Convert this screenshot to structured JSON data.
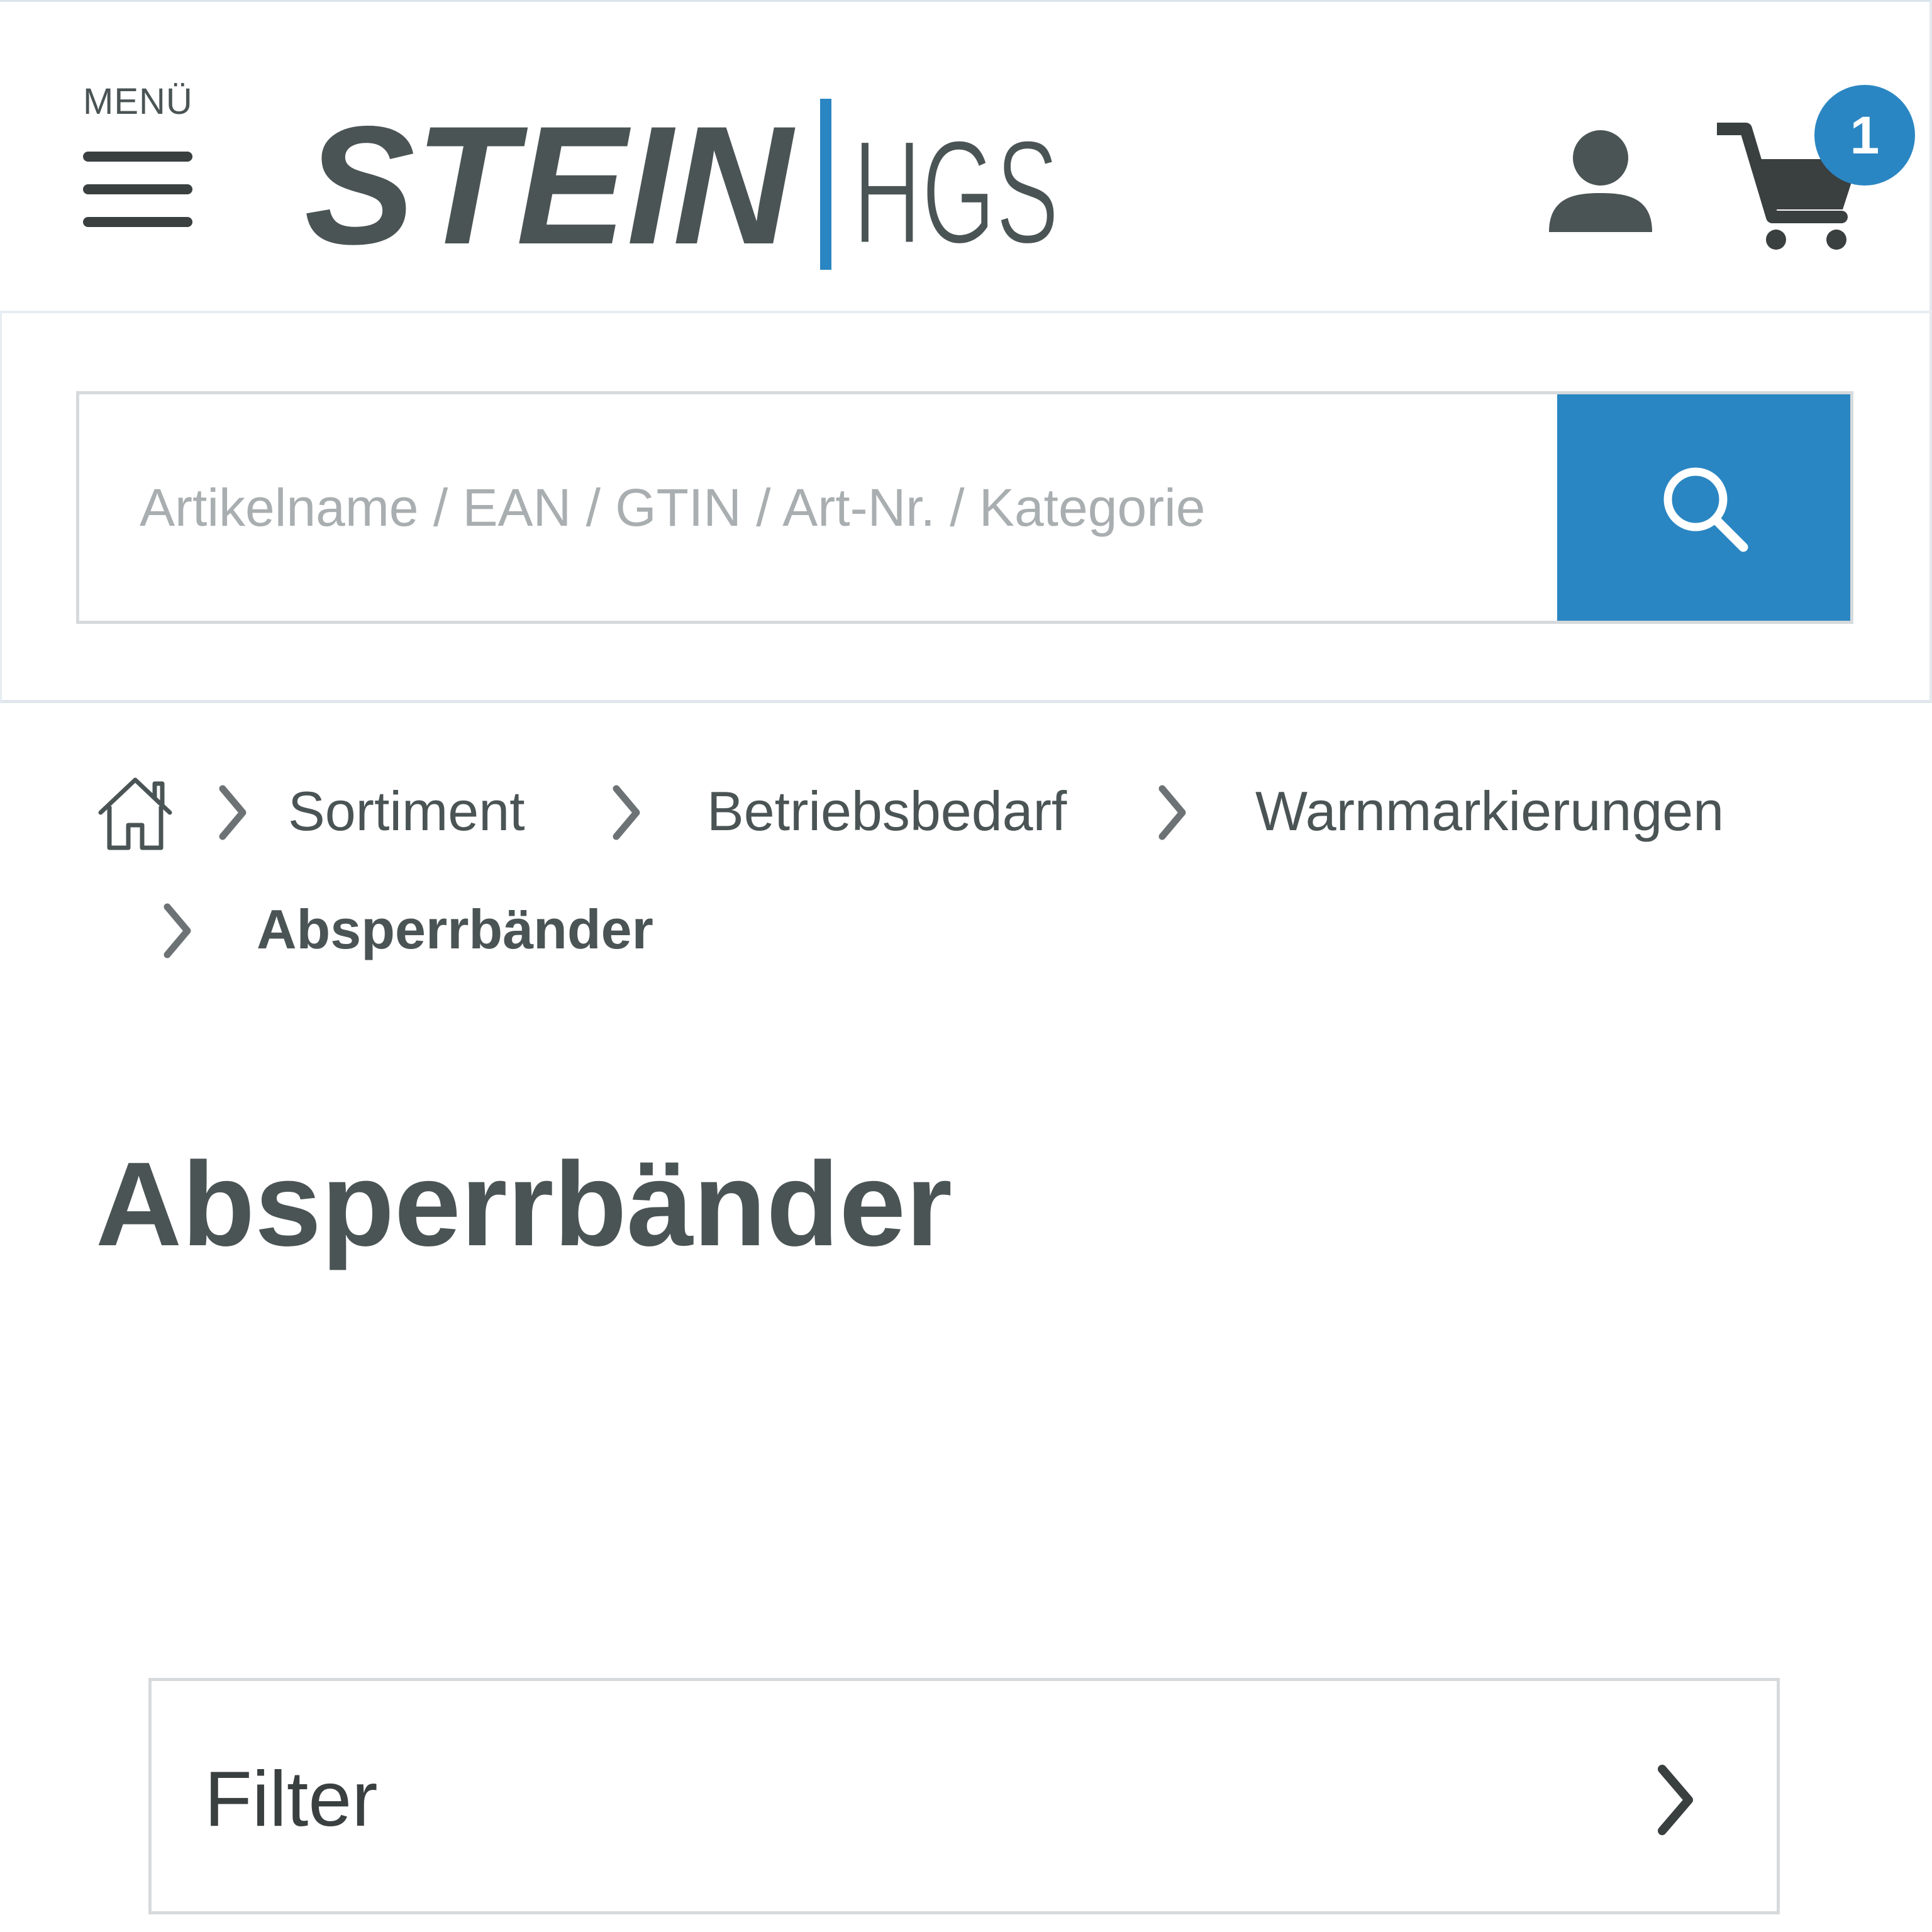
{
  "header": {
    "menu_label": "MENÜ",
    "logo": {
      "word_bold": "STEIN",
      "word_light": "HGS",
      "text_color": "#4b5455",
      "divider_color": "#2a86c2"
    },
    "account_icon": "user-icon",
    "cart_icon": "shopping-cart-icon",
    "cart_count": "1"
  },
  "search": {
    "placeholder": "Artikelname / EAN / GTIN / Art-Nr. / Kategorie",
    "value": "",
    "button_icon": "search-icon"
  },
  "breadcrumb": {
    "home_icon": "home-icon",
    "items": [
      {
        "label": "Sortiment"
      },
      {
        "label": "Betriebsbedarf"
      },
      {
        "label": "Warnmarkierungen"
      }
    ],
    "current": "Absperrbänder"
  },
  "page": {
    "title": "Absperrbänder"
  },
  "filter": {
    "label": "Filter",
    "icon": "chevron-right-icon"
  },
  "colors": {
    "accent": "#2a86c2",
    "text": "#4b5455",
    "border": "#d6dadd",
    "placeholder": "#a9aeb0"
  }
}
